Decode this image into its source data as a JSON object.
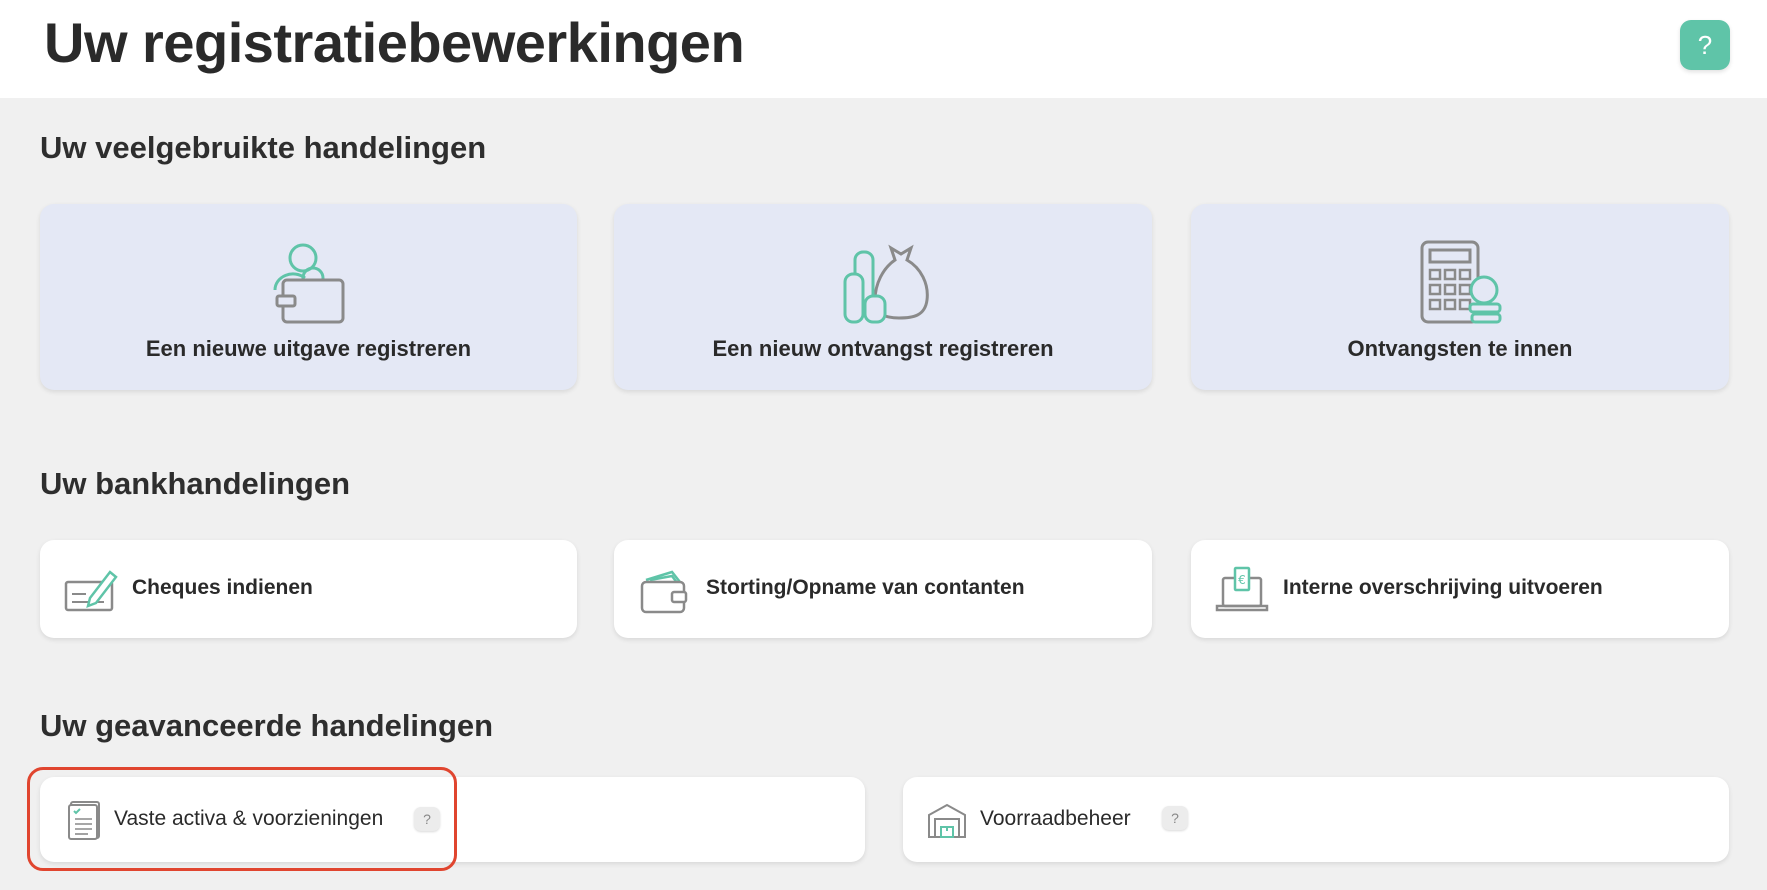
{
  "header": {
    "title": "Uw registratiebewerkingen",
    "help_label": "?"
  },
  "sections": {
    "frequent": {
      "title": "Uw veelgebruikte handelingen",
      "items": [
        {
          "label": "Een nieuwe uitgave registreren",
          "icon": "person-wallet-icon"
        },
        {
          "label": "Een nieuw ontvangst registreren",
          "icon": "money-bag-coins-icon"
        },
        {
          "label": "Ontvangsten te innen",
          "icon": "calculator-coins-icon"
        }
      ]
    },
    "bank": {
      "title": "Uw bankhandelingen",
      "items": [
        {
          "label": "Cheques indienen",
          "icon": "cheque-pen-icon"
        },
        {
          "label": "Storting/Opname van contanten",
          "icon": "wallet-cash-icon"
        },
        {
          "label": "Interne overschrijving uitvoeren",
          "icon": "laptop-euro-icon"
        }
      ]
    },
    "advanced": {
      "title": "Uw geavanceerde handelingen",
      "items": [
        {
          "label": "Vaste activa & voorzieningen",
          "icon": "document-list-icon",
          "help": "?"
        },
        {
          "label": "Voorraadbeheer",
          "icon": "warehouse-icon",
          "help": "?"
        }
      ]
    }
  },
  "colors": {
    "accent": "#5fc4a8",
    "card_highlight_bg": "#e4e8f5",
    "page_bg": "#f0f0f0",
    "highlight_border": "#e0452f"
  }
}
